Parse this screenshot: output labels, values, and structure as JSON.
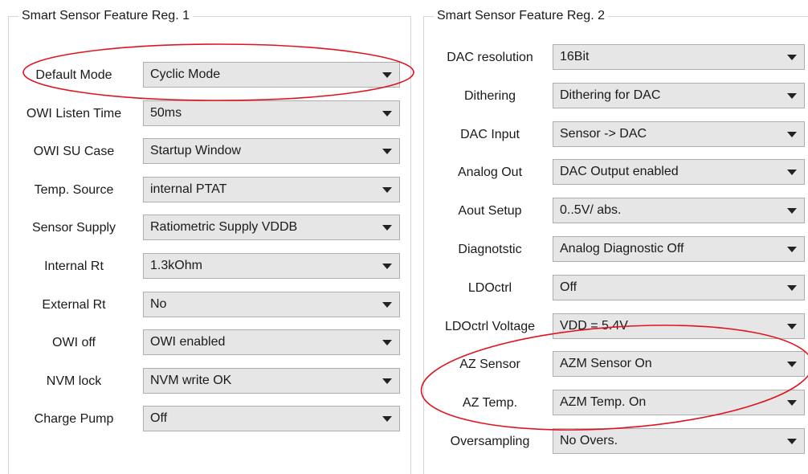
{
  "group1": {
    "title": "Smart Sensor Feature Reg. 1",
    "rows": [
      {
        "label": "Default Mode",
        "value": "Cyclic Mode"
      },
      {
        "label": "OWI Listen Time",
        "value": "50ms"
      },
      {
        "label": "OWI SU Case",
        "value": "Startup Window"
      },
      {
        "label": "Temp. Source",
        "value": "internal PTAT"
      },
      {
        "label": "Sensor Supply",
        "value": "Ratiometric Supply VDDB"
      },
      {
        "label": "Internal Rt",
        "value": "1.3kOhm"
      },
      {
        "label": "External Rt",
        "value": "No"
      },
      {
        "label": "OWI off",
        "value": "OWI enabled"
      },
      {
        "label": "NVM lock",
        "value": "NVM write OK"
      },
      {
        "label": "Charge Pump",
        "value": "Off"
      }
    ]
  },
  "group2": {
    "title": "Smart Sensor Feature Reg. 2",
    "rows": [
      {
        "label": "DAC resolution",
        "value": "16Bit"
      },
      {
        "label": "Dithering",
        "value": "Dithering for DAC"
      },
      {
        "label": "DAC Input",
        "value": "Sensor -> DAC"
      },
      {
        "label": "Analog Out",
        "value": "DAC Output enabled"
      },
      {
        "label": "Aout Setup",
        "value": "0..5V/ abs."
      },
      {
        "label": "Diagnotstic",
        "value": "Analog Diagnostic Off"
      },
      {
        "label": "LDOctrl",
        "value": "Off"
      },
      {
        "label": "LDOctrl Voltage",
        "value": "VDD = 5.4V"
      },
      {
        "label": "AZ Sensor",
        "value": "AZM Sensor On"
      },
      {
        "label": "AZ Temp.",
        "value": "AZM Temp. On"
      },
      {
        "label": "Oversampling",
        "value": "No Overs."
      }
    ]
  },
  "annotation_color": "#e0141e"
}
